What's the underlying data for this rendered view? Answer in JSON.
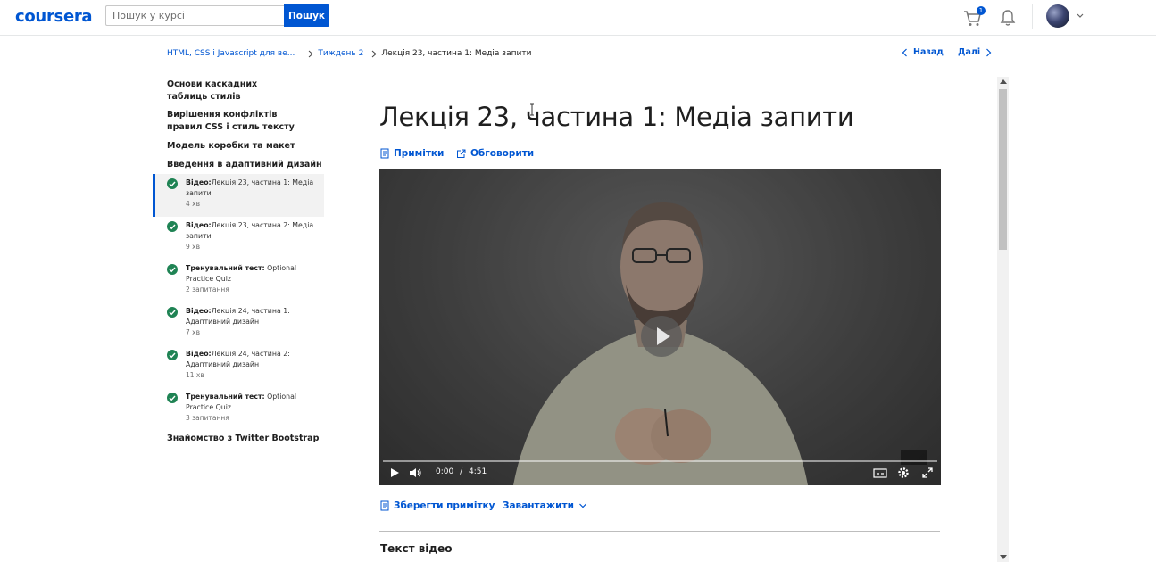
{
  "header": {
    "logo": "coursera",
    "search_placeholder": "Пошук у курсі",
    "search_button": "Пошук",
    "cart_count": "1",
    "icons": {
      "cart": "cart-icon",
      "bell": "bell-icon",
      "avatar_chevron": "chevron-down-icon"
    }
  },
  "breadcrumb": {
    "items": [
      "HTML, CSS і Javascript для ве...",
      "Тиждень 2"
    ],
    "current": "Лекція 23, частина 1: Медіа запити"
  },
  "pager": {
    "prev": "Назад",
    "next": "Далі"
  },
  "sidebar": {
    "sections_top": [
      "Основи каскадних таблиць стилів",
      "Вирішення конфліктів правил CSS і стиль тексту",
      "Модель коробки та макет",
      "Введення в адаптивний дизайн"
    ],
    "lessons": [
      {
        "type": "Відео:",
        "title": "Лекція 23, частина 1: Медіа запити",
        "meta": "4 хв",
        "active": true
      },
      {
        "type": "Відео:",
        "title": "Лекція 23, частина 2: Медіа запити",
        "meta": "9 хв"
      },
      {
        "type": "Тренувальний тест:",
        "title": " Optional Practice Quiz",
        "meta": "2 запитання"
      },
      {
        "type": "Відео:",
        "title": "Лекція 24, частина 1: Адаптивний дизайн",
        "meta": "7 хв"
      },
      {
        "type": "Відео:",
        "title": "Лекція 24, частина 2: Адаптивний дизайн",
        "meta": "11 хв"
      },
      {
        "type": "Тренувальний тест:",
        "title": " Optional Practice Quiz",
        "meta": "3 запитання"
      }
    ],
    "section_bottom": "Знайомство з Twitter Bootstrap"
  },
  "main": {
    "title": "Лекція 23, частина 1: Медіа запити",
    "notes_link": "Примітки",
    "discuss_link": "Обговорити",
    "video": {
      "current_time": "0:00",
      "separator": "/",
      "duration": "4:51",
      "progress": 0
    },
    "save_note": "Зберегти примітку",
    "download": "Завантажити",
    "transcript_title": "Текст відео"
  },
  "colors": {
    "brand": "#0056d2",
    "complete": "#1f8354"
  }
}
